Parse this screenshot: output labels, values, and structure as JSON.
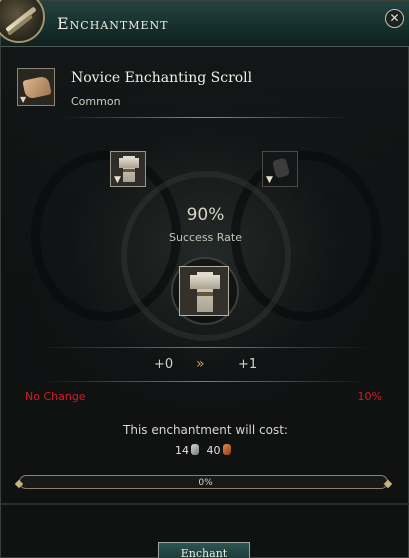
{
  "window": {
    "title": "Enchantment"
  },
  "item": {
    "name": "Novice Enchanting Scroll",
    "rarity": "Common"
  },
  "icons": {
    "title_emblem": "quill-scroll-icon",
    "close": "close-icon",
    "item": "scroll-icon",
    "slot_arrow": "chevron-down-icon",
    "level_arrow": "double-chevron-right-icon",
    "silver_coin": "silver-coin-icon",
    "copper_coin": "copper-coin-icon"
  },
  "success": {
    "value": "90%",
    "label": "Success Rate"
  },
  "levels": {
    "from": "+0",
    "to": "+1",
    "arrow": "»"
  },
  "outcome": {
    "fail_label": "No Change",
    "fail_percent": "10%"
  },
  "cost": {
    "label": "This enchantment will cost:",
    "silver": "14",
    "copper": "40"
  },
  "progress": {
    "value": 0,
    "text": "0%"
  },
  "actions": {
    "enchant": "Enchant"
  },
  "colors": {
    "accent_gold": "#c49a52",
    "fail_red": "#d01d22",
    "title_teal": "#23433f"
  }
}
